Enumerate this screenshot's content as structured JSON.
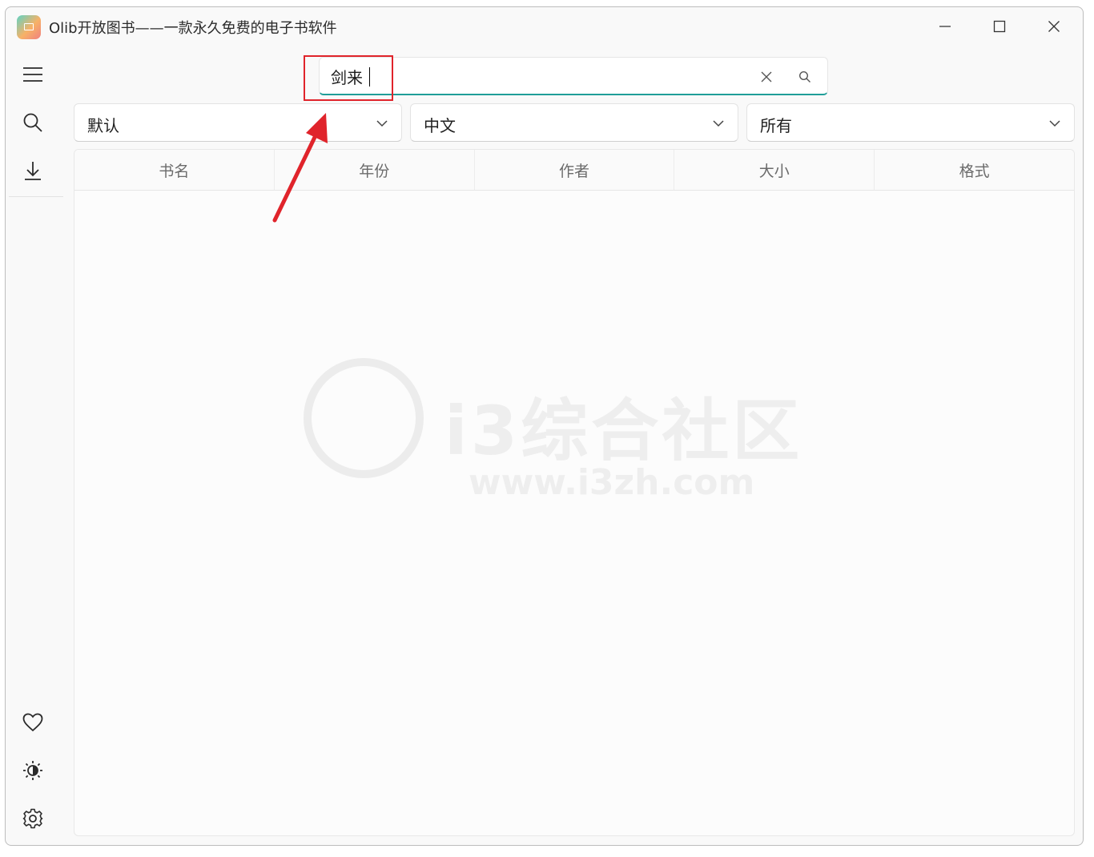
{
  "window": {
    "title": "Olib开放图书——一款永久免费的电子书软件"
  },
  "titlebar_icons": {
    "minimize": "minimize-icon",
    "maximize": "maximize-icon",
    "close": "close-icon"
  },
  "sidebar": {
    "top": [
      {
        "icon": "menu-icon"
      },
      {
        "icon": "search-icon"
      },
      {
        "icon": "download-icon"
      }
    ],
    "bottom": [
      {
        "icon": "heart-icon"
      },
      {
        "icon": "theme-icon"
      },
      {
        "icon": "gear-icon"
      }
    ]
  },
  "search": {
    "value": "剑来",
    "clear_icon": "close-icon",
    "submit_icon": "search-icon"
  },
  "filters": [
    {
      "label": "默认"
    },
    {
      "label": "中文"
    },
    {
      "label": "所有"
    }
  ],
  "table": {
    "columns": [
      "书名",
      "年份",
      "作者",
      "大小",
      "格式"
    ]
  },
  "watermark": {
    "text": "i3综合社区",
    "url": "www.i3zh.com"
  },
  "colors": {
    "accent": "#1f9e98",
    "annotation": "#e0242b"
  }
}
